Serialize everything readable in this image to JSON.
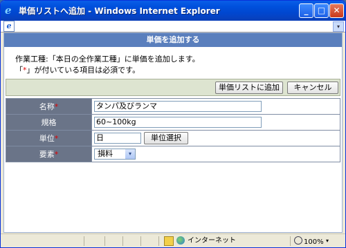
{
  "window": {
    "title": "単価リストへ追加 - Windows Internet Explorer",
    "minimize": "_",
    "maximize": "□",
    "close": "✕"
  },
  "address_bar": {
    "dropdown": "▾",
    "page_icon": "e"
  },
  "page": {
    "heading": "単価を追加する",
    "desc_line1": "作業工種:「本日の全作業工種」に単価を追加します。",
    "desc_line2_open": "「",
    "desc_line2_mark": "*",
    "desc_line2_rest": "」が付いている項目は必須です。"
  },
  "toolbar": {
    "add_button": "単価リストに追加",
    "cancel_button": "キャンセル"
  },
  "form": {
    "required_mark": "*",
    "name_label": "名称",
    "name_value": "タンパ及びランマ",
    "spec_label": "規格",
    "spec_value": "60~100kg",
    "unit_label": "単位",
    "unit_value": "日",
    "unit_select_button": "単位選択",
    "element_label": "要素",
    "element_value": "損料",
    "element_arrow": "▾"
  },
  "status_bar": {
    "zone": "インターネット",
    "zoom": "100%",
    "zoom_arrow": "▾"
  },
  "colors": {
    "header_blue": "#5a7fbd",
    "label_gray": "#6a7488",
    "required_red": "#e00000",
    "toolbar_green": "#dde4d0"
  }
}
